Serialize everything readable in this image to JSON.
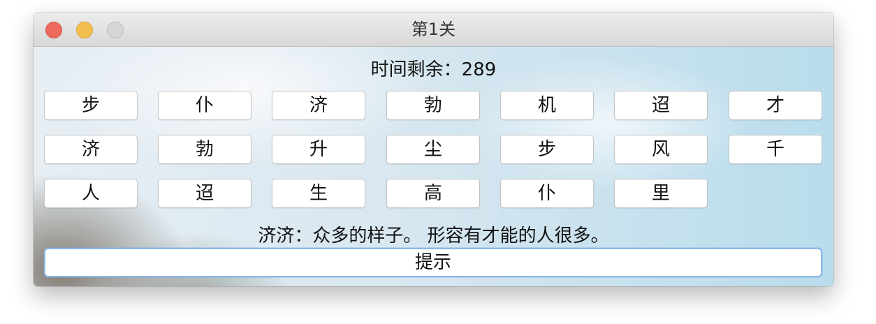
{
  "window": {
    "title": "第1关"
  },
  "timer": {
    "text": "时间剩余：289"
  },
  "tiles": [
    "步",
    "仆",
    "济",
    "勃",
    "机",
    "迢",
    "才",
    "济",
    "勃",
    "升",
    "尘",
    "步",
    "风",
    "千",
    "人",
    "迢",
    "生",
    "高",
    "仆",
    "里"
  ],
  "definition": "济济：众多的样子。 形容有才能的人很多。",
  "hint_button": "提示",
  "colors": {
    "close": "#ec6b5e",
    "minimize": "#f4be4f",
    "zoom": "#d6d6d6",
    "hint_border": "#8fb8e6"
  }
}
